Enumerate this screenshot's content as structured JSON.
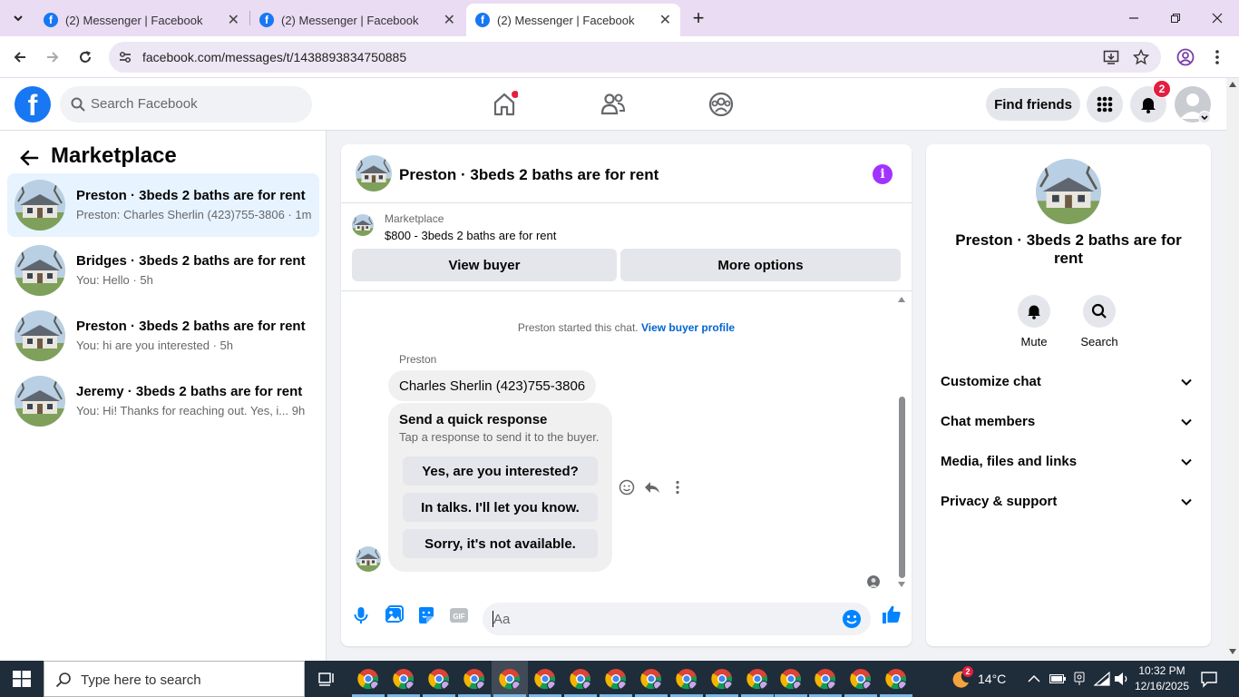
{
  "browser": {
    "tabs": [
      {
        "label": "(2) Messenger | Facebook"
      },
      {
        "label": "(2) Messenger | Facebook"
      },
      {
        "label": "(2) Messenger | Facebook"
      }
    ],
    "url": "facebook.com/messages/t/1438893834750885"
  },
  "header": {
    "search_placeholder": "Search Facebook",
    "find_friends": "Find friends",
    "notification_count": "2"
  },
  "sidebar": {
    "title": "Marketplace",
    "conversations": [
      {
        "title": "Preston · 3beds 2 baths are for rent",
        "snippet": "Preston: Charles Sherlin (423)755-3806 · 1m"
      },
      {
        "title": "Bridges · 3beds 2 baths are for rent",
        "snippet": "You: Hello · 5h"
      },
      {
        "title": "Preston · 3beds 2 baths are for rent",
        "snippet": "You: hi are you interested · 5h"
      },
      {
        "title": "Jeremy · 3beds 2 baths are for rent",
        "snippet": "You: Hi! Thanks for reaching out. Yes, i... 9h"
      }
    ]
  },
  "chat": {
    "title": "Preston · 3beds 2 baths are for rent",
    "listing_source": "Marketplace",
    "listing_price": "$800 - 3beds 2 baths are for rent",
    "view_buyer": "View buyer",
    "more_options": "More options",
    "started_text": "Preston started this chat.",
    "view_buyer_profile": "View buyer profile",
    "sender_name": "Preston",
    "message": "Charles Sherlin (423)755-3806",
    "quick_title": "Send a quick response",
    "quick_subtitle": "Tap a response to send it to the buyer.",
    "quick_responses": [
      "Yes, are you interested?",
      "In talks. I'll let you know.",
      "Sorry, it's not available."
    ],
    "input_placeholder": "Aa"
  },
  "details": {
    "title": "Preston · 3beds 2 baths are for rent",
    "mute": "Mute",
    "search": "Search",
    "sections": [
      "Customize chat",
      "Chat members",
      "Media, files and links",
      "Privacy & support"
    ]
  },
  "taskbar": {
    "search_placeholder": "Type here to search",
    "weather_badge": "2",
    "temperature": "14°C",
    "time": "10:32 PM",
    "date": "12/16/2025"
  },
  "colors": {
    "brand": "#1877f2",
    "selected_row": "#e7f3ff",
    "accent_purple": "#a033ff",
    "badge_red": "#e41e3f"
  }
}
